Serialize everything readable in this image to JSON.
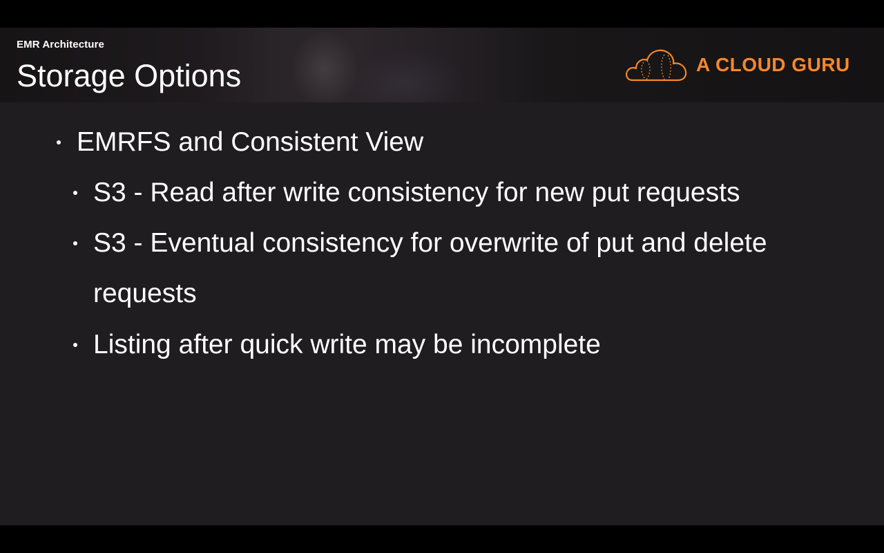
{
  "header": {
    "kicker": "EMR Architecture",
    "title": "Storage Options",
    "logo_text": "A CLOUD GURU",
    "logo_icon": "cloud-icon",
    "brand_color": "#f5882a"
  },
  "bullets": [
    {
      "level": 1,
      "text": "EMRFS and Consistent View"
    },
    {
      "level": 2,
      "text": "S3 - Read after write consistency for new put requests"
    },
    {
      "level": 2,
      "text": "S3 - Eventual consistency for overwrite of put and delete",
      "continuation": "requests"
    },
    {
      "level": 2,
      "text": "Listing after quick write may be incomplete"
    }
  ]
}
